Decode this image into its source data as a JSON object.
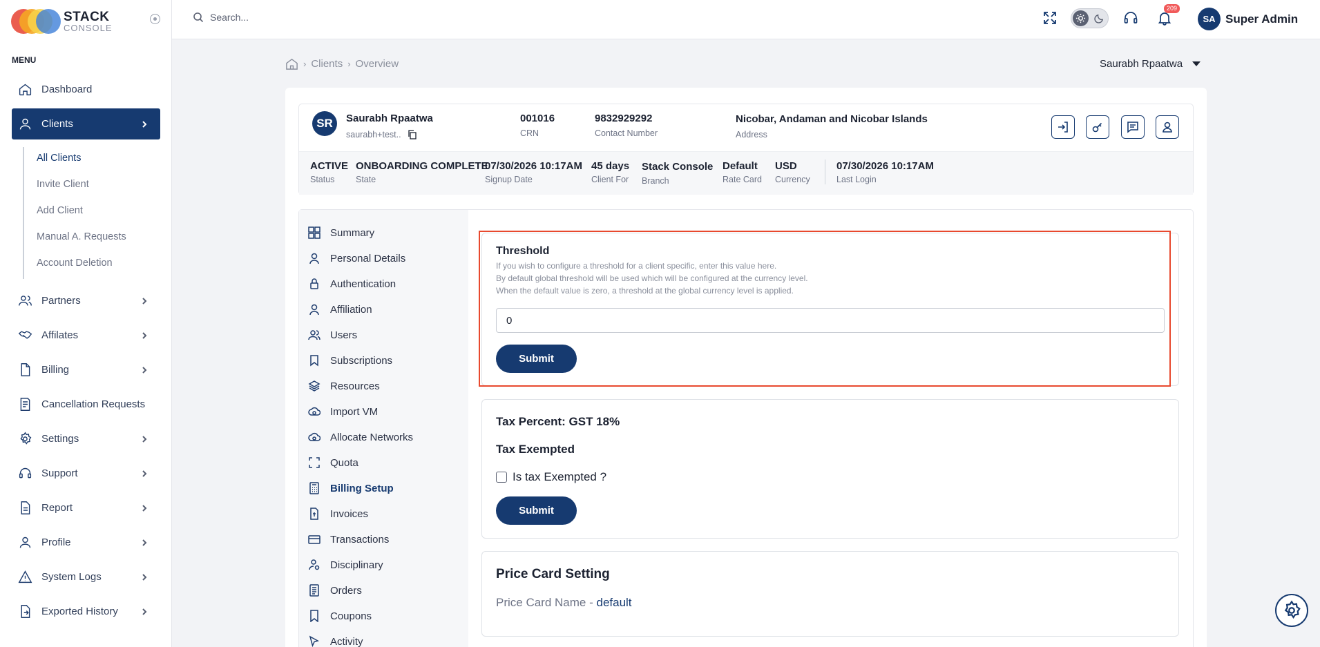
{
  "app": {
    "logo_primary": "STACK",
    "logo_secondary": "CONSOLE"
  },
  "sidebar": {
    "menu_title": "MENU",
    "items": [
      {
        "label": "Dashboard",
        "icon": "home-icon"
      },
      {
        "label": "Clients",
        "icon": "user-icon"
      },
      {
        "label": "Partners",
        "icon": "users-icon"
      },
      {
        "label": "Affilates",
        "icon": "handshake-icon"
      },
      {
        "label": "Billing",
        "icon": "file-icon"
      },
      {
        "label": "Cancellation Requests",
        "icon": "document-icon"
      },
      {
        "label": "Settings",
        "icon": "gear-icon"
      },
      {
        "label": "Support",
        "icon": "headset-icon"
      },
      {
        "label": "Report",
        "icon": "report-icon"
      },
      {
        "label": "Profile",
        "icon": "user-icon"
      },
      {
        "label": "System Logs",
        "icon": "warning-icon"
      },
      {
        "label": "Exported History",
        "icon": "export-icon"
      }
    ],
    "sub_items": [
      "All Clients",
      "Invite Client",
      "Add Client",
      "Manual A. Requests",
      "Account Deletion"
    ]
  },
  "topbar": {
    "search_placeholder": "Search...",
    "notification_count": "209",
    "user_initials": "SA",
    "user_name": "Super Admin"
  },
  "breadcrumb": {
    "items": [
      "Clients",
      "Overview"
    ]
  },
  "client_switch": "Saurabh Rpaatwa",
  "client": {
    "initials": "SR",
    "name": "Saurabh Rpaatwa",
    "email": "saurabh+test..",
    "crn": "001016",
    "crn_label": "CRN",
    "contact": "9832929292",
    "contact_label": "Contact Number",
    "address": "Nicobar, Andaman and Nicobar Islands",
    "address_label": "Address",
    "status": "ACTIVE",
    "status_label": "Status",
    "state": "ONBOARDING COMPLETE",
    "state_label": "State",
    "signup": "07/30/2026 10:17AM",
    "signup_label": "Signup Date",
    "client_for": "45 days",
    "client_for_label": "Client For",
    "branch": "Stack Console",
    "branch_label": "Branch",
    "rate_card": "Default",
    "rate_card_label": "Rate Card",
    "currency": "USD",
    "currency_label": "Currency",
    "last_login": "07/30/2026 10:17AM",
    "last_login_label": "Last Login"
  },
  "tabs": [
    "Summary",
    "Personal Details",
    "Authentication",
    "Affiliation",
    "Users",
    "Subscriptions",
    "Resources",
    "Import VM",
    "Allocate Networks",
    "Quota",
    "Billing Setup",
    "Invoices",
    "Transactions",
    "Disciplinary",
    "Orders",
    "Coupons",
    "Activity"
  ],
  "active_tab": "Billing Setup",
  "threshold": {
    "title": "Threshold",
    "desc1": "If you wish to configure a threshold for a client specific, enter this value here.",
    "desc2": "By default global threshold will be used which will be configured at the currency level.",
    "desc3": "When the default value is zero, a threshold at the global currency level is applied.",
    "value": "0",
    "submit": "Submit"
  },
  "tax": {
    "percent_label": "Tax Percent: GST 18%",
    "exempt_title": "Tax Exempted",
    "checkbox_label": "Is tax Exempted ?",
    "submit": "Submit"
  },
  "price_card": {
    "title": "Price Card Setting",
    "name_label": "Price Card Name - ",
    "name_value": "default"
  },
  "colors": {
    "primary": "#163a70",
    "highlight": "#e8492e",
    "badge": "#f15a5a"
  }
}
